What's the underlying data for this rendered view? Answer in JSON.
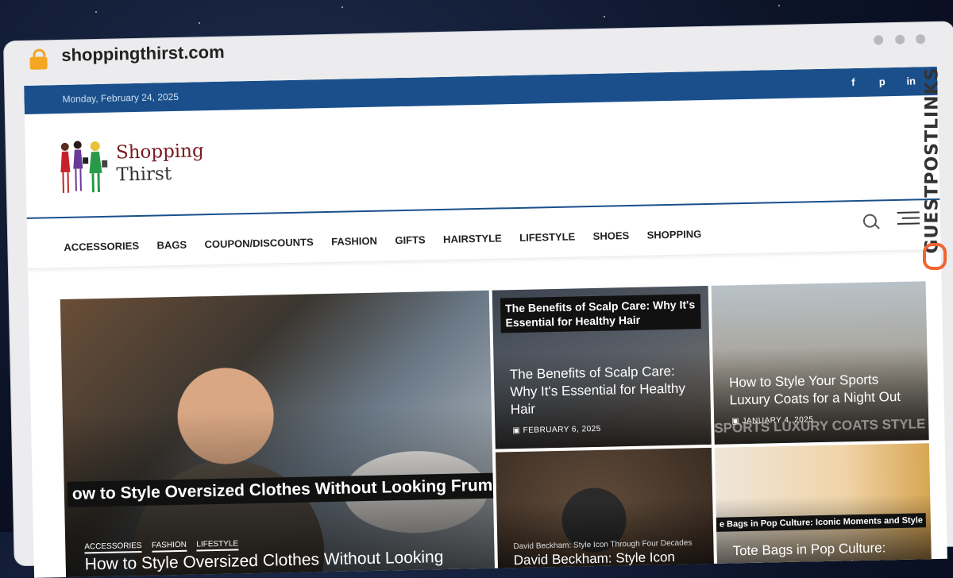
{
  "browser": {
    "url": "shoppingthirst.com"
  },
  "topbar": {
    "date": "Monday, February 24, 2025",
    "social": [
      {
        "icon": "facebook-icon",
        "glyph": "f"
      },
      {
        "icon": "pinterest-icon",
        "glyph": "p"
      },
      {
        "icon": "linkedin-icon",
        "glyph": "in"
      }
    ]
  },
  "logo": {
    "line1": "Shopping",
    "line2": "Thirst"
  },
  "nav": {
    "items": [
      "ACCESSORIES",
      "BAGS",
      "COUPON/DISCOUNTS",
      "FASHION",
      "GIFTS",
      "HAIRSTYLE",
      "LIFESTYLE",
      "SHOES",
      "SHOPPING"
    ]
  },
  "featured": {
    "banner": "ow to Style Oversized Clothes Without Looking Frump",
    "tags": [
      "ACCESSORIES",
      "FASHION",
      "LIFESTYLE"
    ],
    "title": "How to Style Oversized Clothes Without Looking"
  },
  "posts": [
    {
      "banner": "The Benefits of Scalp Care: Why It's Essential for Healthy Hair",
      "title": "The Benefits of Scalp Care: Why It's Essential for Healthy Hair",
      "date": "FEBRUARY 6, 2025"
    },
    {
      "banner": "SPORTS LUXURY COATS STYLE",
      "title": "How to Style Your Sports Luxury Coats for a Night Out",
      "date": "JANUARY 4, 2025"
    },
    {
      "banner": "David Beckham: Style Icon Through Four Decades",
      "title": "David Beckham: Style Icon"
    },
    {
      "banner": "e Bags in Pop Culture: Iconic Moments and Style",
      "title": "Tote Bags in Pop Culture: Iconic Moments and Styles"
    }
  ],
  "side_brand": {
    "text": "GUESTPOSTLINKS"
  },
  "colors": {
    "topbar": "#1a4f8b",
    "logo_accent": "#7a1a20",
    "brand_orange": "#f06533"
  }
}
